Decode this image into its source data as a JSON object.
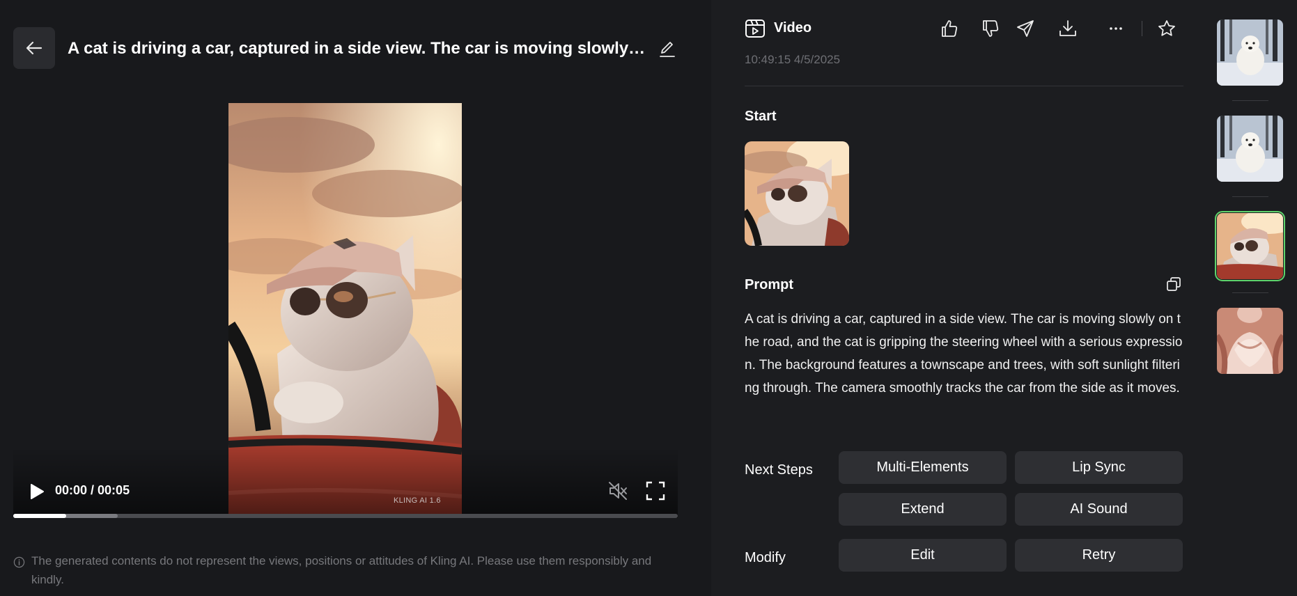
{
  "header": {
    "title": "A cat is driving a car, captured in a side view. The car is moving slowly on the road, and the cat is gripping the steering wheel with a serious expression."
  },
  "player": {
    "current_time": "00:00",
    "duration": "00:05",
    "time_display": "00:00 / 00:05",
    "progress_played": 0.08,
    "progress_buffered": 0.157,
    "watermark": "KLING AI 1.6"
  },
  "disclaimer": "The generated contents do not represent the views, positions or attitudes of Kling AI. Please use them responsibly and kindly.",
  "detail": {
    "type_label": "Video",
    "timestamp": "10:49:15 4/5/2025",
    "start_label": "Start",
    "prompt_label": "Prompt",
    "prompt_text": "A cat is driving a car, captured in a side view. The car is moving slowly on the road, and the cat is gripping the steering wheel with a serious expression. The background features a townscape and trees, with soft sunlight filtering through. The camera smoothly tracks the car from the side as it moves.",
    "next_steps_label": "Next Steps",
    "modify_label": "Modify",
    "next_steps": [
      "Multi-Elements",
      "Lip Sync",
      "Extend",
      "AI Sound"
    ],
    "modify": [
      "Edit",
      "Retry"
    ]
  },
  "icons": {
    "back": "arrow-left-icon",
    "edit": "pencil-icon",
    "video": "video-clip-icon",
    "like": "thumbs-up-icon",
    "dislike": "thumbs-down-icon",
    "share": "send-icon",
    "download": "download-icon",
    "more": "more-icon",
    "favorite": "star-icon",
    "copy": "copy-icon",
    "play": "play-icon",
    "mute": "muted-speaker-icon",
    "fullscreen": "fullscreen-icon",
    "info": "info-icon"
  },
  "colors": {
    "active_outline": "#5ed26b",
    "panel_bg": "#1c1d20",
    "button_bg": "#2e2f33"
  }
}
